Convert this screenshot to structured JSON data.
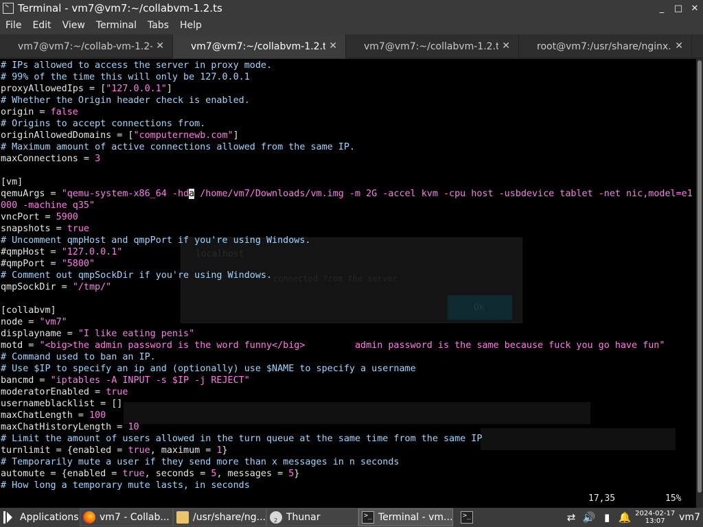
{
  "window": {
    "title": "Terminal - vm7@vm7:~/collabvm-1.2.ts",
    "minimize": "_",
    "maximize": "□",
    "close": "✕"
  },
  "menu": [
    "File",
    "Edit",
    "View",
    "Terminal",
    "Tabs",
    "Help"
  ],
  "tabs": [
    {
      "label": "vm7@vm7:~/collab-vm-1.2-...",
      "close": "✕"
    },
    {
      "label": "vm7@vm7:~/collabvm-1.2.ts",
      "close": "✕"
    },
    {
      "label": "vm7@vm7:~/collabvm-1.2.ts",
      "close": "✕"
    },
    {
      "label": "root@vm7:/usr/share/nginx...",
      "close": "✕"
    }
  ],
  "terminal": {
    "lines": [
      [
        [
          "com",
          "# IPs allowed to access the server in proxy mode."
        ]
      ],
      [
        [
          "com",
          "# 99% of the time this will only be 127.0.0.1"
        ]
      ],
      [
        [
          "",
          "proxyAllowedIps = ["
        ],
        [
          "str",
          "\"127.0.0.1\""
        ],
        [
          "",
          "]"
        ]
      ],
      [
        [
          "com",
          "# Whether the Origin header check is enabled."
        ]
      ],
      [
        [
          "",
          "origin = "
        ],
        [
          "kw",
          "false"
        ]
      ],
      [
        [
          "com",
          "# Origins to accept connections from."
        ]
      ],
      [
        [
          "",
          "originAllowedDomains = ["
        ],
        [
          "str",
          "\"computernewb.com\""
        ],
        [
          "",
          "]"
        ]
      ],
      [
        [
          "com",
          "# Maximum amount of active connections allowed from the same IP."
        ]
      ],
      [
        [
          "",
          "maxConnections = "
        ],
        [
          "kw",
          "3"
        ]
      ],
      [
        [
          "",
          ""
        ]
      ],
      [
        [
          "sec",
          "[vm]"
        ]
      ],
      [
        [
          "",
          "qemuArgs = "
        ],
        [
          "str",
          "\"qemu-system-x86_64 -hd"
        ],
        [
          "cur",
          "a"
        ],
        [
          "str",
          " /home/vm7/Downloads/vm.img -m 2G -accel kvm -cpu host -usbdevice tablet -net nic,model=e1"
        ]
      ],
      [
        [
          "str",
          "000 -machine q35\""
        ]
      ],
      [
        [
          "",
          "vncPort = "
        ],
        [
          "kw",
          "5900"
        ]
      ],
      [
        [
          "",
          "snapshots = "
        ],
        [
          "kw",
          "true"
        ]
      ],
      [
        [
          "com",
          "# Uncomment qmpHost and qmpPort if you're using Windows."
        ]
      ],
      [
        [
          "",
          "#qmpHost = "
        ],
        [
          "str",
          "\"127.0.0.1\""
        ]
      ],
      [
        [
          "",
          "#qmpPort = "
        ],
        [
          "str",
          "\"5800\""
        ]
      ],
      [
        [
          "com",
          "# Comment out qmpSockDir if you're using Windows."
        ]
      ],
      [
        [
          "",
          "qmpSockDir = "
        ],
        [
          "str",
          "\"/tmp/\""
        ]
      ],
      [
        [
          "",
          ""
        ]
      ],
      [
        [
          "sec",
          "[collabvm]"
        ]
      ],
      [
        [
          "",
          "node = "
        ],
        [
          "str",
          "\"vm7\""
        ]
      ],
      [
        [
          "",
          "displayname = "
        ],
        [
          "str",
          "\"I like eating penis\""
        ]
      ],
      [
        [
          "",
          "motd = "
        ],
        [
          "str",
          "\"<big>the admin password is the word funny</big>         admin password is the same because fuck you go have fun\""
        ]
      ],
      [
        [
          "com",
          "# Command used to ban an IP."
        ]
      ],
      [
        [
          "com",
          "# Use $IP to specify an ip and (optionally) use $NAME to specify a username"
        ]
      ],
      [
        [
          "",
          "bancmd = "
        ],
        [
          "str",
          "\"iptables -A INPUT -s $IP -j REJECT\""
        ]
      ],
      [
        [
          "",
          "moderatorEnabled = "
        ],
        [
          "kw",
          "true"
        ]
      ],
      [
        [
          "",
          "usernameblacklist = []"
        ]
      ],
      [
        [
          "",
          "maxChatLength = "
        ],
        [
          "kw",
          "100"
        ]
      ],
      [
        [
          "",
          "maxChatHistoryLength = "
        ],
        [
          "kw",
          "10"
        ]
      ],
      [
        [
          "com",
          "# Limit the amount of users allowed in the turn queue at the same time from the same IP"
        ]
      ],
      [
        [
          "",
          "turnlimit = {enabled = "
        ],
        [
          "kw",
          "true"
        ],
        [
          "",
          ", maximum = "
        ],
        [
          "kw",
          "1"
        ],
        [
          "",
          "}"
        ]
      ],
      [
        [
          "com",
          "# Temporarily mute a user if they send more than x messages in n seconds"
        ]
      ],
      [
        [
          "",
          "automute = {enabled = "
        ],
        [
          "kw",
          "true"
        ],
        [
          "",
          ", seconds = "
        ],
        [
          "kw",
          "5"
        ],
        [
          "",
          ", messages = "
        ],
        [
          "kw",
          "5"
        ],
        [
          "",
          "}"
        ]
      ],
      [
        [
          "com",
          "# How long a temporary mute lasts, in seconds"
        ]
      ]
    ],
    "position": "17,35",
    "percent": "15%"
  },
  "ghost": {
    "dialog_host": "localhost",
    "dialog_msg": "connected from the server",
    "dialog_ok": "Ok"
  },
  "taskbar": {
    "applications": "Applications",
    "items": [
      "vm7 - Collab...",
      "/usr/share/ng...",
      "Thunar",
      "Terminal - vm..."
    ],
    "thunar_badge": "2",
    "date": "2024-02-17",
    "time": "13:07",
    "user": "vm7"
  },
  "colors": {
    "comment": "#9fd6ff",
    "string": "#ff7ce9",
    "text": "#e6e6e6",
    "background": "#000000"
  }
}
